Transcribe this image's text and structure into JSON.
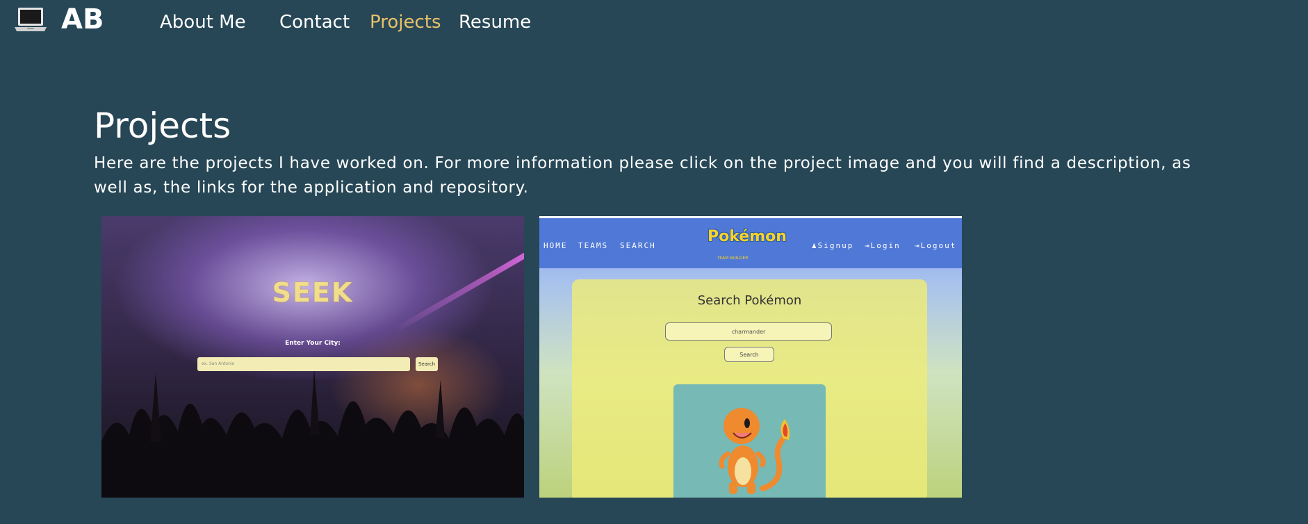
{
  "brand": {
    "logo_text": "AB",
    "icon": "laptop-icon"
  },
  "nav": {
    "links": [
      {
        "label": "About Me",
        "active": false
      },
      {
        "label": "Contact",
        "active": false
      },
      {
        "label": "Projects",
        "active": true
      },
      {
        "label": "Resume",
        "active": false
      }
    ]
  },
  "colors": {
    "background": "#274756",
    "text": "#ffffff",
    "active_link": "#e8c268"
  },
  "page": {
    "title": "Projects",
    "intro": "Here are the projects I have worked on. For more information please click on the project image and you will find a description, as well as, the links for the application and repository."
  },
  "projects": [
    {
      "name": "seek",
      "screenshot": {
        "title": "SEEK",
        "prompt": "Enter Your City:",
        "input_placeholder": "ex. San Antonio",
        "button": "Search"
      }
    },
    {
      "name": "pokemon-team-builder",
      "screenshot": {
        "nav_links": [
          "HOME",
          "TEAMS",
          "SEARCH"
        ],
        "auth_links": [
          "Signup",
          "Login",
          "Logout"
        ],
        "logo": "Pokémon",
        "logo_sub": "TEAM BUILDER",
        "search_title": "Search Pokémon",
        "input_value": "charmander",
        "button": "Search"
      }
    }
  ]
}
